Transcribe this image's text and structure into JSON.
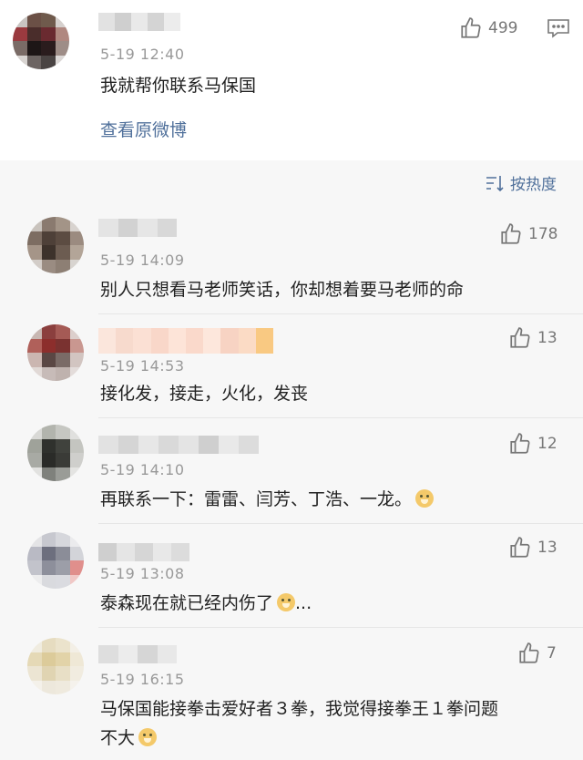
{
  "top_comment": {
    "time": "5-19 12:40",
    "likes": "499",
    "text": "我就帮你联系马保国",
    "view_original": "查看原微博"
  },
  "sort_label": "按热度",
  "comments": [
    {
      "time": "5-19 14:09",
      "likes": "178",
      "text": "别人只想看马老师笑话，你却想着要马老师的命"
    },
    {
      "time": "5-19 14:53",
      "likes": "13",
      "text": "接化发，接走，火化，发丧"
    },
    {
      "time": "5-19 14:10",
      "likes": "12",
      "text": "再联系一下：雷雷、闫芳、丁浩、一龙。"
    },
    {
      "time": "5-19 13:08",
      "likes": "13",
      "text": "泰森现在就已经内伤了",
      "suffix": "..."
    },
    {
      "time": "5-19 16:15",
      "likes": "7",
      "text_line1": "马保国能接拳击爱好者３拳，我觉得接拳王１拳问题",
      "text_line2": "不大"
    }
  ],
  "icons": {
    "like": "thumbs-up-icon",
    "comment": "comment-icon",
    "sort": "sort-icon",
    "emoji": "doge-emoji-icon"
  },
  "colors": {
    "link": "#50709b",
    "time": "#999999",
    "background": "#f7f7f7"
  }
}
